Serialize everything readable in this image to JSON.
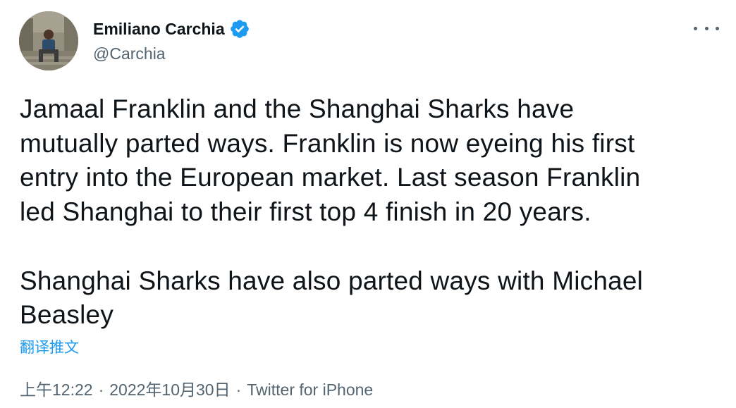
{
  "author": {
    "display_name": "Emiliano Carchia",
    "handle": "@Carchia",
    "verified": true
  },
  "tweet": {
    "text": "Jamaal Franklin and the Shanghai Sharks have\nmutually parted ways. Franklin is now eyeing his first\nentry into the European market. Last season Franklin\nled Shanghai to their first top 4 finish in 20 years.\n\nShanghai Sharks have also parted ways with Michael\nBeasley",
    "translate_label": "翻译推文",
    "time": "上午12:22",
    "date": "2022年10月30日",
    "separator": "·",
    "source": "Twitter for iPhone"
  },
  "icons": {
    "verified": "verified-badge-icon",
    "more": "more-options-icon"
  },
  "colors": {
    "primary_text": "#0f1419",
    "secondary_text": "#536471",
    "link": "#1d9bf0",
    "verified_badge": "#1d9bf0"
  }
}
